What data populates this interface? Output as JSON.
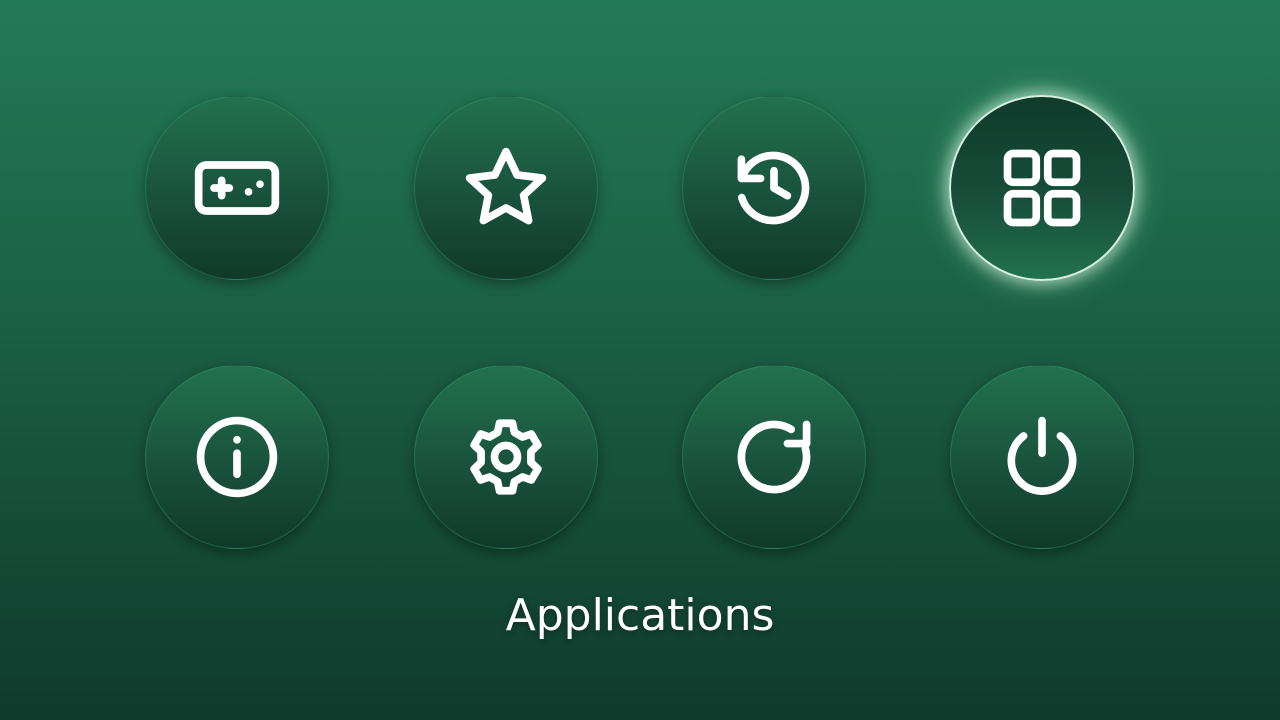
{
  "menu": {
    "selected_label": "Applications",
    "items": [
      {
        "icon": "gamepad-icon"
      },
      {
        "icon": "star-icon"
      },
      {
        "icon": "history-icon"
      },
      {
        "icon": "grid-icon",
        "selected": true
      },
      {
        "icon": "info-icon"
      },
      {
        "icon": "gear-icon"
      },
      {
        "icon": "restart-icon"
      },
      {
        "icon": "power-icon"
      }
    ]
  },
  "colors": {
    "background_top": "#237a58",
    "background_bottom": "#0f3a2c",
    "focus_ring": "#d8efe2",
    "icon": "#ffffff"
  }
}
